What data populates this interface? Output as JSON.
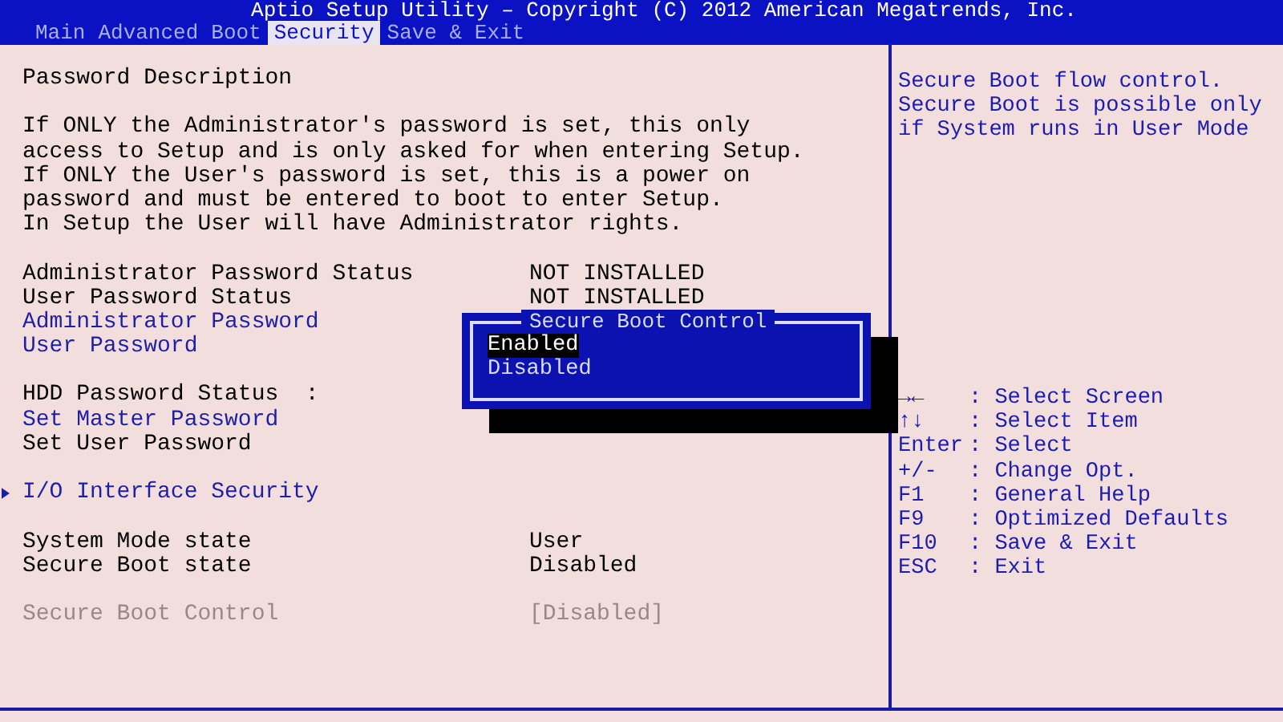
{
  "title": "Aptio Setup Utility – Copyright (C) 2012 American Megatrends, Inc.",
  "tabs": [
    {
      "label": "Main",
      "selected": false
    },
    {
      "label": "Advanced",
      "selected": false
    },
    {
      "label": "Boot",
      "selected": false
    },
    {
      "label": "Security",
      "selected": true
    },
    {
      "label": "Save & Exit",
      "selected": false
    }
  ],
  "sections": [
    [
      {
        "kind": "text",
        "label": "Password Description"
      }
    ],
    [
      {
        "kind": "text",
        "label": "If ONLY the Administrator's password is set, this only"
      },
      {
        "kind": "text",
        "label": "access to Setup and is only asked for when entering Setup."
      },
      {
        "kind": "text",
        "label": "If ONLY the User's password is set, this is a power on"
      },
      {
        "kind": "text",
        "label": "password and must be entered to boot to enter Setup."
      },
      {
        "kind": "text",
        "label": "In Setup the User will have Administrator rights."
      }
    ],
    [
      {
        "kind": "status",
        "label": "Administrator Password Status",
        "value": "NOT INSTALLED"
      },
      {
        "kind": "status",
        "label": "User Password Status",
        "value": "NOT INSTALLED"
      },
      {
        "kind": "link",
        "label": "Administrator Password"
      },
      {
        "kind": "link",
        "label": "User Password"
      }
    ],
    [
      {
        "kind": "text",
        "label": "HDD Password Status  :"
      },
      {
        "kind": "link",
        "label": "Set Master Password"
      },
      {
        "kind": "text",
        "label": "Set User Password"
      }
    ],
    [
      {
        "kind": "submenu",
        "label": "I/O Interface Security"
      }
    ],
    [
      {
        "kind": "status",
        "label": "System Mode state",
        "value": "User"
      },
      {
        "kind": "status",
        "label": "Secure Boot state",
        "value": "Disabled"
      }
    ],
    [
      {
        "kind": "setting",
        "label": "Secure Boot Control",
        "value": "[Disabled]",
        "disabled": true
      }
    ]
  ],
  "popup": {
    "title": "Secure Boot Control",
    "options": [
      {
        "label": "Enabled",
        "selected": true
      },
      {
        "label": "Disabled",
        "selected": false
      }
    ]
  },
  "help": {
    "lines": [
      "Secure Boot flow control.",
      "Secure Boot is possible only",
      "if System runs in User Mode"
    ]
  },
  "keys": [
    {
      "key": "→←",
      "action": ": Select Screen"
    },
    {
      "key": "↑↓",
      "action": ": Select Item"
    },
    {
      "key": "Enter",
      "action": ": Select"
    },
    {
      "key": "+/-",
      "action": ": Change Opt."
    },
    {
      "key": "F1",
      "action": ": General Help"
    },
    {
      "key": "F9",
      "action": ": Optimized Defaults"
    },
    {
      "key": "F10",
      "action": ": Save & Exit"
    },
    {
      "key": "ESC",
      "action": ": Exit"
    }
  ]
}
